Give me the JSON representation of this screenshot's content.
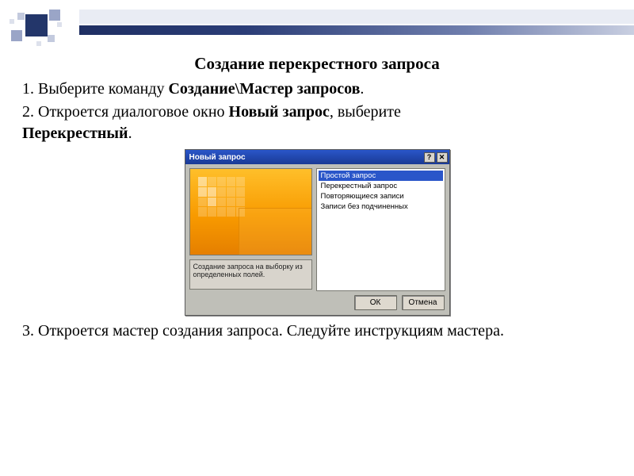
{
  "title": "Создание перекрестного запроса",
  "step1": {
    "prefix": "1. Выберите команду ",
    "bold": "Создание\\Мастер запросов",
    "suffix": "."
  },
  "step2": {
    "prefix": "2. Откроется  диалоговое окно ",
    "bold1": "Новый запрос",
    "mid": ", выберите ",
    "bold2": "Перекрестный",
    "suffix": "."
  },
  "step3": "3. Откроется мастер создания запроса. Следуйте инструкциям мастера.",
  "dialog": {
    "title": "Новый запрос",
    "help_btn": "?",
    "close_btn": "✕",
    "description": "Создание запроса на выборку из определенных полей.",
    "options": [
      "Простой запрос",
      "Перекрестный запрос",
      "Повторяющиеся записи",
      "Записи без подчиненных"
    ],
    "ok": "ОК",
    "cancel": "Отмена"
  }
}
